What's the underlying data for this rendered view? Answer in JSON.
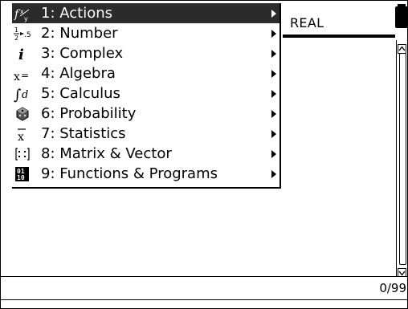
{
  "status": {
    "mode": "REAL"
  },
  "entry": {
    "count": "0/99"
  },
  "menu": {
    "items": [
      {
        "number": "1",
        "label": "1: Actions",
        "icon": "actions-icon",
        "selected": true
      },
      {
        "number": "2",
        "label": "2: Number",
        "icon": "number-fraction-icon"
      },
      {
        "number": "3",
        "label": "3: Complex",
        "icon": "complex-i-icon"
      },
      {
        "number": "4",
        "label": "4: Algebra",
        "icon": "algebra-icon"
      },
      {
        "number": "5",
        "label": "5: Calculus",
        "icon": "calculus-integral-icon"
      },
      {
        "number": "6",
        "label": "6: Probability",
        "icon": "probability-die-icon"
      },
      {
        "number": "7",
        "label": "7: Statistics",
        "icon": "statistics-xbar-icon"
      },
      {
        "number": "8",
        "label": "8: Matrix & Vector",
        "icon": "matrix-icon"
      },
      {
        "number": "9",
        "label": "9: Functions & Programs",
        "icon": "functions-programs-icon"
      }
    ]
  }
}
